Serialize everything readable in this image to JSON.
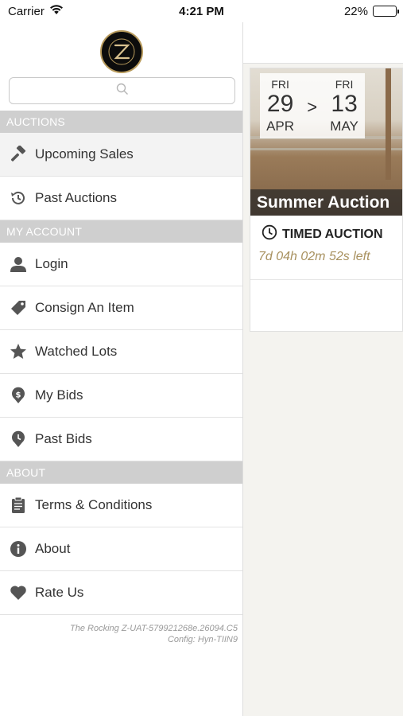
{
  "status_bar": {
    "carrier": "Carrier",
    "time": "4:21 PM",
    "battery": "22%",
    "battery_level": 0.22
  },
  "menu": {
    "search": {
      "placeholder": ""
    },
    "sections": [
      {
        "title": "AUCTIONS",
        "items": [
          {
            "label": "Upcoming Sales",
            "icon": "gavel-icon",
            "active": true
          },
          {
            "label": "Past Auctions",
            "icon": "history-icon"
          }
        ]
      },
      {
        "title": "MY ACCOUNT",
        "items": [
          {
            "label": "Login",
            "icon": "user-icon"
          },
          {
            "label": "Consign An Item",
            "icon": "tag-icon"
          },
          {
            "label": "Watched Lots",
            "icon": "star-icon"
          },
          {
            "label": "My Bids",
            "icon": "dollar-pin-icon"
          },
          {
            "label": "Past Bids",
            "icon": "clock-pin-icon"
          }
        ]
      },
      {
        "title": "ABOUT",
        "items": [
          {
            "label": "Terms & Conditions",
            "icon": "clipboard-icon"
          },
          {
            "label": "About",
            "icon": "info-icon"
          },
          {
            "label": "Rate Us",
            "icon": "heart-icon"
          }
        ]
      }
    ],
    "footer": {
      "version": "The Rocking Z-UAT-579921268e.26094.C5",
      "config": "Config: Hyn-TIIN9"
    }
  },
  "auction_card": {
    "start": {
      "dow": "FRI",
      "day": "29",
      "month": "APR"
    },
    "separator": ">",
    "end": {
      "dow": "FRI",
      "day": "13",
      "month": "MAY"
    },
    "title": "Summer Auction",
    "type": "TIMED AUCTION",
    "countdown": "7d 04h 02m 52s left"
  },
  "colors": {
    "accent_gold": "#a8915f",
    "section_bg": "#cfcfcf",
    "content_bg": "#f4f3ef"
  }
}
